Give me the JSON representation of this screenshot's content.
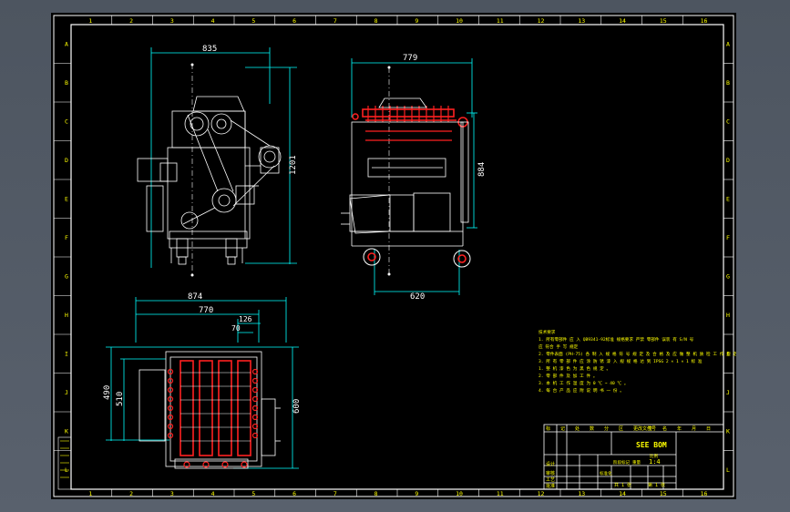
{
  "drawing": {
    "title_block_name": "SEE BOM",
    "column_zones": [
      "1",
      "2",
      "3",
      "4",
      "5",
      "6",
      "7",
      "8",
      "9",
      "10",
      "11",
      "12",
      "13",
      "14",
      "15",
      "16"
    ],
    "row_zones": [
      "A",
      "B",
      "C",
      "D",
      "E",
      "F",
      "G",
      "H",
      "I",
      "J",
      "K",
      "L"
    ],
    "dims": {
      "front_width": "835",
      "front_height": "1201",
      "side_top_width": "779",
      "side_height": "884",
      "side_wheel_span": "620",
      "plan_overall": "874",
      "plan_width": "770",
      "plan_small_a": "126",
      "plan_small_b": "70",
      "plan_left_outer": "490",
      "plan_left_inner": "510",
      "plan_right": "600"
    },
    "notes": [
      "技术要求",
      "1. 所有零部件 应 入 QB9341-92标准 规格要求   严禁 零部件 误装 有 S/N 号",
      "   应 符合 手 写 规定",
      "2. 零件表面 (PH-75) 各 制 入 规 格 符 号 规 定 及  合 格 及 应 做 整 机 质 检 工 作 规 定",
      "3. 所 有 零 部 件 应  涂 防 锈 漆  入 规  规 格 达 到 IPSG 2 × 1 × 1 标 准",
      "   1.  整 机 漆 色 为 黑 色 规 定 。",
      "   2.  零 部 件 及 加 工 件 。",
      "   3.  本 机 工 作 温 度 为 0 ℃ ~ 40 ℃ 。",
      "   4.  每 台 产 品 应 附 说 明 书 一 份 。"
    ],
    "title_block": {
      "header_cells": [
        "标",
        "记",
        "处",
        "数",
        "分",
        "区",
        "更改文件号",
        "签",
        "名",
        "年",
        "月",
        "日"
      ],
      "side_labels": [
        "设计",
        "审核",
        "工艺",
        "批准"
      ],
      "row_labels": [
        "标准化",
        "阶段标记",
        "重量",
        "比例"
      ],
      "scale": "1:4",
      "sheet_info": [
        "共 1 张",
        "第 1 张"
      ]
    }
  }
}
